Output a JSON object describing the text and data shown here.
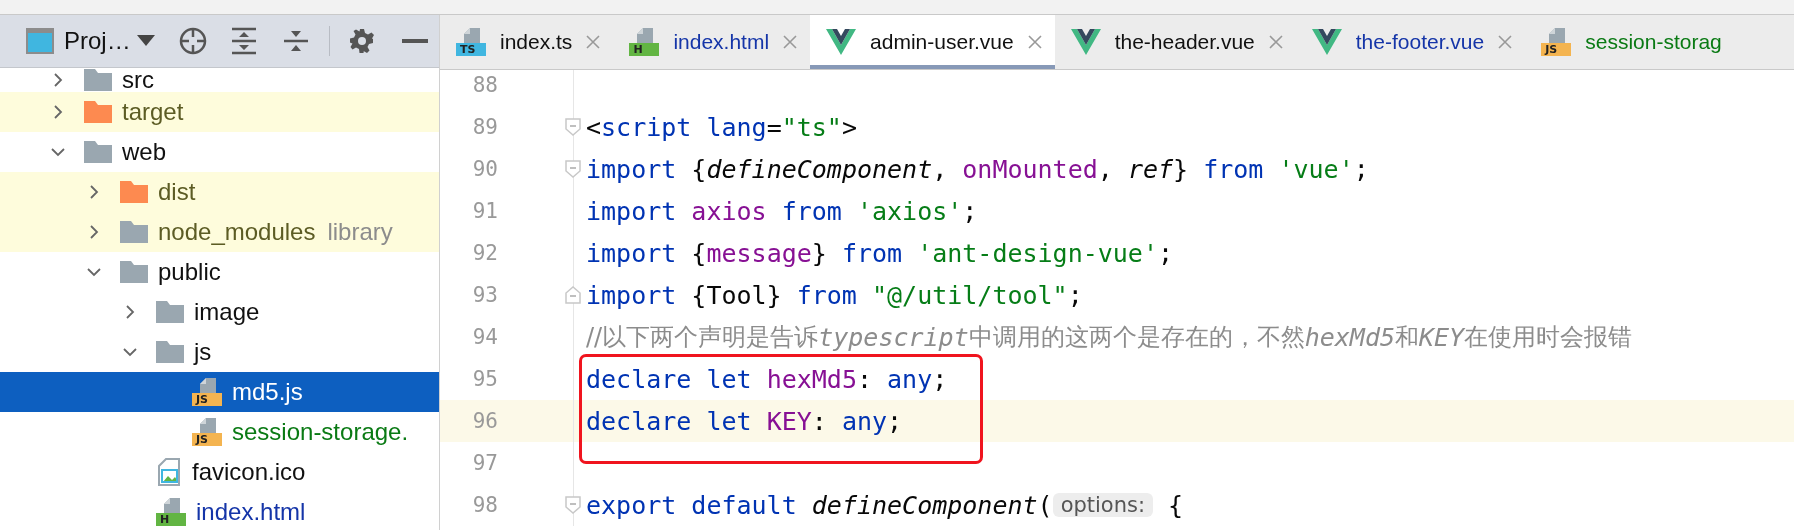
{
  "project_panel": {
    "title": "Proj…",
    "tree": [
      {
        "label": "src",
        "kind": "folder",
        "excluded": false,
        "expanded": false,
        "selected": false
      },
      {
        "label": "target",
        "kind": "folder-excluded",
        "color": "#5c5c24",
        "excluded": true,
        "expanded": false,
        "selected": false
      },
      {
        "label": "web",
        "kind": "folder",
        "excluded": false,
        "expanded": true,
        "selected": false,
        "children": [
          {
            "label": "dist",
            "kind": "folder-excluded",
            "color": "#5c5c24",
            "excluded": true,
            "expanded": false,
            "selected": false
          },
          {
            "label": "node_modules",
            "hint": "library",
            "kind": "folder",
            "color": "#5c5c24",
            "excluded": true,
            "expanded": false,
            "selected": false
          },
          {
            "label": "public",
            "kind": "folder",
            "excluded": false,
            "expanded": true,
            "selected": false,
            "children": [
              {
                "label": "image",
                "kind": "folder",
                "excluded": false,
                "expanded": false,
                "selected": false
              },
              {
                "label": "js",
                "kind": "folder",
                "excluded": false,
                "expanded": true,
                "selected": false,
                "children": [
                  {
                    "label": "md5.js",
                    "kind": "file",
                    "badge": "JS",
                    "excluded": false,
                    "selected": true
                  },
                  {
                    "label": "session-storage.",
                    "kind": "file",
                    "badge": "JS",
                    "color": "#0a7a14",
                    "excluded": false,
                    "selected": false
                  }
                ]
              },
              {
                "label": "favicon.ico",
                "kind": "image-file",
                "excluded": false,
                "selected": false
              },
              {
                "label": "index.html",
                "kind": "file",
                "badge": "H",
                "color": "#1535a8",
                "excluded": false,
                "selected": false
              }
            ]
          }
        ]
      }
    ]
  },
  "tabs": [
    {
      "label": "index.ts",
      "kind": "file",
      "badge": "TS",
      "selected": false,
      "closable": true
    },
    {
      "label": "index.html",
      "kind": "file",
      "badge": "H",
      "color": "#1535a8",
      "selected": false,
      "closable": true
    },
    {
      "label": "admin-user.vue",
      "kind": "vue",
      "selected": true,
      "closable": true
    },
    {
      "label": "the-header.vue",
      "kind": "vue",
      "selected": false,
      "closable": true
    },
    {
      "label": "the-footer.vue",
      "kind": "vue",
      "color": "#1535a8",
      "selected": false,
      "closable": true
    },
    {
      "label": "session-storag",
      "kind": "file",
      "badge": "JS",
      "color": "#0a7a14",
      "selected": false,
      "closable": false
    }
  ],
  "editor": {
    "lines": [
      {
        "number": "88",
        "kind": "plain",
        "current": false,
        "boxed": false
      },
      {
        "number": "89",
        "kind": "fold-start",
        "current": false,
        "boxed": false,
        "tokens": [
          {
            "kind": "plain",
            "text": "<"
          },
          {
            "kind": "kw",
            "text": "script lang"
          },
          {
            "kind": "plain",
            "text": "="
          },
          {
            "kind": "str",
            "text": "\"ts\""
          },
          {
            "kind": "plain",
            "text": ">"
          }
        ]
      },
      {
        "number": "90",
        "kind": "fold-start",
        "current": false,
        "boxed": false,
        "tokens": [
          {
            "kind": "kw",
            "text": "import "
          },
          {
            "kind": "plain",
            "text": "{"
          },
          {
            "kind": "italic",
            "text": "defineComponent"
          },
          {
            "kind": "plain",
            "text": ", "
          },
          {
            "kind": "var",
            "text": "onMounted"
          },
          {
            "kind": "plain",
            "text": ", "
          },
          {
            "kind": "italic",
            "text": "ref"
          },
          {
            "kind": "plain",
            "text": "} "
          },
          {
            "kind": "kw",
            "text": "from "
          },
          {
            "kind": "str",
            "text": "'vue'"
          },
          {
            "kind": "plain",
            "text": ";"
          }
        ]
      },
      {
        "number": "91",
        "kind": "plain",
        "current": false,
        "boxed": false,
        "tokens": [
          {
            "kind": "kw",
            "text": "import "
          },
          {
            "kind": "var",
            "text": "axios "
          },
          {
            "kind": "kw",
            "text": "from "
          },
          {
            "kind": "str",
            "text": "'axios'"
          },
          {
            "kind": "plain",
            "text": ";"
          }
        ]
      },
      {
        "number": "92",
        "kind": "plain",
        "current": false,
        "boxed": false,
        "tokens": [
          {
            "kind": "kw",
            "text": "import "
          },
          {
            "kind": "plain",
            "text": "{"
          },
          {
            "kind": "var",
            "text": "message"
          },
          {
            "kind": "plain",
            "text": "} "
          },
          {
            "kind": "kw",
            "text": "from "
          },
          {
            "kind": "str",
            "text": "'ant-design-vue'"
          },
          {
            "kind": "plain",
            "text": ";"
          }
        ]
      },
      {
        "number": "93",
        "kind": "fold-end",
        "current": false,
        "boxed": false,
        "tokens": [
          {
            "kind": "kw",
            "text": "import "
          },
          {
            "kind": "plain",
            "text": "{Tool} "
          },
          {
            "kind": "kw",
            "text": "from "
          },
          {
            "kind": "str",
            "text": "\"@/util/tool\""
          },
          {
            "kind": "plain",
            "text": ";"
          }
        ]
      },
      {
        "number": "94",
        "kind": "plain",
        "current": false,
        "boxed": false,
        "tokens": [
          {
            "kind": "comment",
            "text": "//以下两个声明是告诉"
          },
          {
            "kind": "comment-italic",
            "text": "typescript"
          },
          {
            "kind": "comment",
            "text": "中调用的这两个是存在的，不然"
          },
          {
            "kind": "comment-italic",
            "text": "hexMd5"
          },
          {
            "kind": "comment",
            "text": "和"
          },
          {
            "kind": "comment-italic",
            "text": "KEY"
          },
          {
            "kind": "comment",
            "text": "在使用时会报错"
          }
        ]
      },
      {
        "number": "95",
        "kind": "plain",
        "current": false,
        "boxed": true,
        "tokens": [
          {
            "kind": "kw",
            "text": "declare let "
          },
          {
            "kind": "var",
            "text": "hexMd5"
          },
          {
            "kind": "plain",
            "text": ": "
          },
          {
            "kind": "kw",
            "text": "any"
          },
          {
            "kind": "plain",
            "text": ";"
          }
        ]
      },
      {
        "number": "96",
        "kind": "plain",
        "current": true,
        "boxed": true,
        "tokens": [
          {
            "kind": "kw",
            "text": "declare let "
          },
          {
            "kind": "var",
            "text": "KEY"
          },
          {
            "kind": "plain",
            "text": ": "
          },
          {
            "kind": "kw",
            "text": "any"
          },
          {
            "kind": "plain",
            "text": ";"
          }
        ]
      },
      {
        "number": "97",
        "kind": "plain",
        "current": false,
        "boxed": false
      },
      {
        "number": "98",
        "kind": "fold-start",
        "current": false,
        "boxed": false,
        "tokens": [
          {
            "kind": "kw",
            "text": "export default "
          },
          {
            "kind": "italic",
            "text": "defineComponent"
          },
          {
            "kind": "plain",
            "text": "("
          },
          {
            "kind": "hint",
            "text": "options:"
          },
          {
            "kind": "plain",
            "text": " {"
          }
        ]
      }
    ]
  }
}
